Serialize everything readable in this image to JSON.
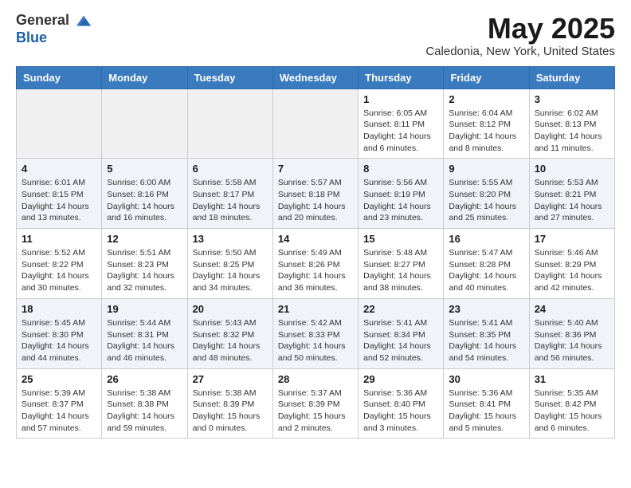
{
  "header": {
    "logo_general": "General",
    "logo_blue": "Blue",
    "title": "May 2025",
    "subtitle": "Caledonia, New York, United States"
  },
  "days_of_week": [
    "Sunday",
    "Monday",
    "Tuesday",
    "Wednesday",
    "Thursday",
    "Friday",
    "Saturday"
  ],
  "weeks": [
    [
      {
        "day": "",
        "info": ""
      },
      {
        "day": "",
        "info": ""
      },
      {
        "day": "",
        "info": ""
      },
      {
        "day": "",
        "info": ""
      },
      {
        "day": "1",
        "info": "Sunrise: 6:05 AM\nSunset: 8:11 PM\nDaylight: 14 hours\nand 6 minutes."
      },
      {
        "day": "2",
        "info": "Sunrise: 6:04 AM\nSunset: 8:12 PM\nDaylight: 14 hours\nand 8 minutes."
      },
      {
        "day": "3",
        "info": "Sunrise: 6:02 AM\nSunset: 8:13 PM\nDaylight: 14 hours\nand 11 minutes."
      }
    ],
    [
      {
        "day": "4",
        "info": "Sunrise: 6:01 AM\nSunset: 8:15 PM\nDaylight: 14 hours\nand 13 minutes."
      },
      {
        "day": "5",
        "info": "Sunrise: 6:00 AM\nSunset: 8:16 PM\nDaylight: 14 hours\nand 16 minutes."
      },
      {
        "day": "6",
        "info": "Sunrise: 5:58 AM\nSunset: 8:17 PM\nDaylight: 14 hours\nand 18 minutes."
      },
      {
        "day": "7",
        "info": "Sunrise: 5:57 AM\nSunset: 8:18 PM\nDaylight: 14 hours\nand 20 minutes."
      },
      {
        "day": "8",
        "info": "Sunrise: 5:56 AM\nSunset: 8:19 PM\nDaylight: 14 hours\nand 23 minutes."
      },
      {
        "day": "9",
        "info": "Sunrise: 5:55 AM\nSunset: 8:20 PM\nDaylight: 14 hours\nand 25 minutes."
      },
      {
        "day": "10",
        "info": "Sunrise: 5:53 AM\nSunset: 8:21 PM\nDaylight: 14 hours\nand 27 minutes."
      }
    ],
    [
      {
        "day": "11",
        "info": "Sunrise: 5:52 AM\nSunset: 8:22 PM\nDaylight: 14 hours\nand 30 minutes."
      },
      {
        "day": "12",
        "info": "Sunrise: 5:51 AM\nSunset: 8:23 PM\nDaylight: 14 hours\nand 32 minutes."
      },
      {
        "day": "13",
        "info": "Sunrise: 5:50 AM\nSunset: 8:25 PM\nDaylight: 14 hours\nand 34 minutes."
      },
      {
        "day": "14",
        "info": "Sunrise: 5:49 AM\nSunset: 8:26 PM\nDaylight: 14 hours\nand 36 minutes."
      },
      {
        "day": "15",
        "info": "Sunrise: 5:48 AM\nSunset: 8:27 PM\nDaylight: 14 hours\nand 38 minutes."
      },
      {
        "day": "16",
        "info": "Sunrise: 5:47 AM\nSunset: 8:28 PM\nDaylight: 14 hours\nand 40 minutes."
      },
      {
        "day": "17",
        "info": "Sunrise: 5:46 AM\nSunset: 8:29 PM\nDaylight: 14 hours\nand 42 minutes."
      }
    ],
    [
      {
        "day": "18",
        "info": "Sunrise: 5:45 AM\nSunset: 8:30 PM\nDaylight: 14 hours\nand 44 minutes."
      },
      {
        "day": "19",
        "info": "Sunrise: 5:44 AM\nSunset: 8:31 PM\nDaylight: 14 hours\nand 46 minutes."
      },
      {
        "day": "20",
        "info": "Sunrise: 5:43 AM\nSunset: 8:32 PM\nDaylight: 14 hours\nand 48 minutes."
      },
      {
        "day": "21",
        "info": "Sunrise: 5:42 AM\nSunset: 8:33 PM\nDaylight: 14 hours\nand 50 minutes."
      },
      {
        "day": "22",
        "info": "Sunrise: 5:41 AM\nSunset: 8:34 PM\nDaylight: 14 hours\nand 52 minutes."
      },
      {
        "day": "23",
        "info": "Sunrise: 5:41 AM\nSunset: 8:35 PM\nDaylight: 14 hours\nand 54 minutes."
      },
      {
        "day": "24",
        "info": "Sunrise: 5:40 AM\nSunset: 8:36 PM\nDaylight: 14 hours\nand 56 minutes."
      }
    ],
    [
      {
        "day": "25",
        "info": "Sunrise: 5:39 AM\nSunset: 8:37 PM\nDaylight: 14 hours\nand 57 minutes."
      },
      {
        "day": "26",
        "info": "Sunrise: 5:38 AM\nSunset: 8:38 PM\nDaylight: 14 hours\nand 59 minutes."
      },
      {
        "day": "27",
        "info": "Sunrise: 5:38 AM\nSunset: 8:39 PM\nDaylight: 15 hours\nand 0 minutes."
      },
      {
        "day": "28",
        "info": "Sunrise: 5:37 AM\nSunset: 8:39 PM\nDaylight: 15 hours\nand 2 minutes."
      },
      {
        "day": "29",
        "info": "Sunrise: 5:36 AM\nSunset: 8:40 PM\nDaylight: 15 hours\nand 3 minutes."
      },
      {
        "day": "30",
        "info": "Sunrise: 5:36 AM\nSunset: 8:41 PM\nDaylight: 15 hours\nand 5 minutes."
      },
      {
        "day": "31",
        "info": "Sunrise: 5:35 AM\nSunset: 8:42 PM\nDaylight: 15 hours\nand 6 minutes."
      }
    ]
  ]
}
